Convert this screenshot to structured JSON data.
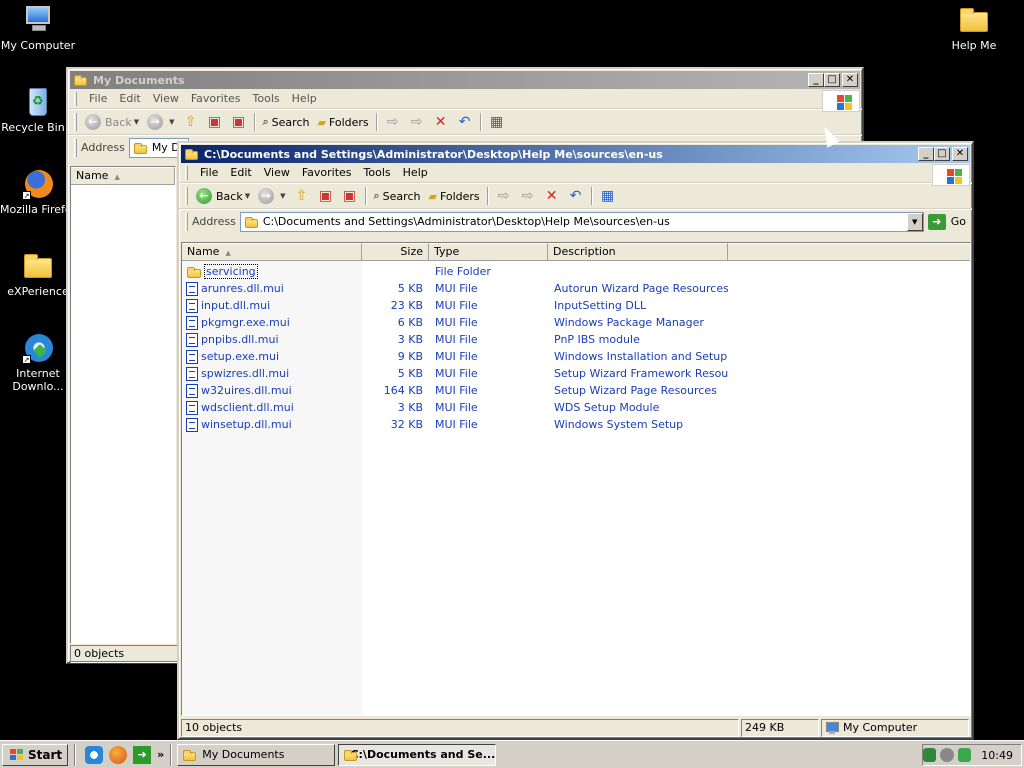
{
  "desktop": {
    "icons": [
      {
        "label": "My Computer",
        "icon": "my-computer-icon"
      },
      {
        "label": "Recycle Bin",
        "icon": "recycle-bin-icon"
      },
      {
        "label": "Mozilla Firefox",
        "icon": "firefox-icon"
      },
      {
        "label": "eXPerience",
        "icon": "folder-icon"
      },
      {
        "label": "Internet Downlo...",
        "icon": "internet-download-icon"
      },
      {
        "label": "Help Me",
        "icon": "folder-icon"
      }
    ]
  },
  "back_window": {
    "title": "My Documents",
    "menu": [
      "File",
      "Edit",
      "View",
      "Favorites",
      "Tools",
      "Help"
    ],
    "toolbar": {
      "back": "Back",
      "search": "Search",
      "folders": "Folders"
    },
    "address_label": "Address",
    "address_value": "My Do",
    "column_name": "Name",
    "status": "0 objects"
  },
  "front_window": {
    "title": "C:\\Documents and Settings\\Administrator\\Desktop\\Help Me\\sources\\en-us",
    "menu": [
      "File",
      "Edit",
      "View",
      "Favorites",
      "Tools",
      "Help"
    ],
    "toolbar": {
      "back": "Back",
      "search": "Search",
      "folders": "Folders"
    },
    "address_label": "Address",
    "address_value": "C:\\Documents and Settings\\Administrator\\Desktop\\Help Me\\sources\\en-us",
    "go_label": "Go",
    "columns": [
      "Name",
      "Size",
      "Type",
      "Description"
    ],
    "rows": [
      {
        "name": "servicing",
        "size": "",
        "type": "File Folder",
        "desc": "",
        "kind": "folder"
      },
      {
        "name": "arunres.dll.mui",
        "size": "5 KB",
        "type": "MUI File",
        "desc": "Autorun Wizard Page Resources",
        "kind": "file"
      },
      {
        "name": "input.dll.mui",
        "size": "23 KB",
        "type": "MUI File",
        "desc": "InputSetting DLL",
        "kind": "file"
      },
      {
        "name": "pkgmgr.exe.mui",
        "size": "6 KB",
        "type": "MUI File",
        "desc": "Windows Package Manager",
        "kind": "file"
      },
      {
        "name": "pnpibs.dll.mui",
        "size": "3 KB",
        "type": "MUI File",
        "desc": "PnP IBS module",
        "kind": "file"
      },
      {
        "name": "setup.exe.mui",
        "size": "9 KB",
        "type": "MUI File",
        "desc": "Windows Installation and Setup",
        "kind": "file"
      },
      {
        "name": "spwizres.dll.mui",
        "size": "5 KB",
        "type": "MUI File",
        "desc": "Setup Wizard Framework Resou...",
        "kind": "file"
      },
      {
        "name": "w32uires.dll.mui",
        "size": "164 KB",
        "type": "MUI File",
        "desc": "Setup Wizard Page Resources",
        "kind": "file"
      },
      {
        "name": "wdsclient.dll.mui",
        "size": "3 KB",
        "type": "MUI File",
        "desc": "WDS Setup Module",
        "kind": "file"
      },
      {
        "name": "winsetup.dll.mui",
        "size": "32 KB",
        "type": "MUI File",
        "desc": "Windows System Setup",
        "kind": "file"
      }
    ],
    "status": {
      "objects": "10 objects",
      "size": "249 KB",
      "location": "My Computer"
    }
  },
  "taskbar": {
    "start_label": "Start",
    "tasks": [
      {
        "label": "My Documents",
        "active": false
      },
      {
        "label": "C:\\Documents and Se...",
        "active": true
      }
    ],
    "clock": "10:49"
  }
}
